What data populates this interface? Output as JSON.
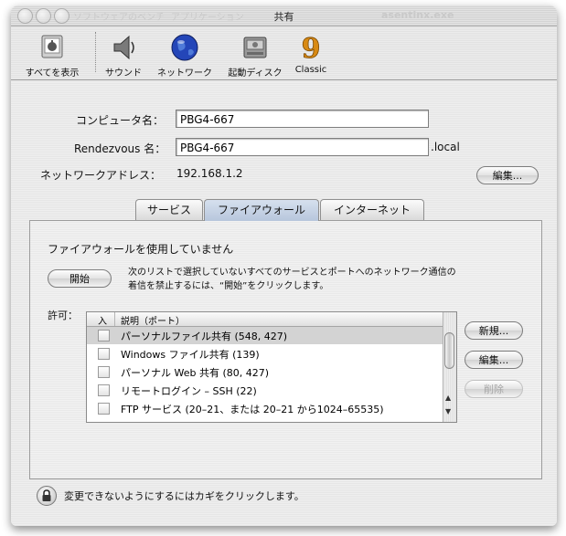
{
  "window": {
    "title": "共有",
    "ghost_left": "ソフトウェアのベンチ",
    "ghost_mid": "アプリケーション",
    "ghost_right": "asentinx.exe"
  },
  "toolbar": {
    "items": [
      {
        "label": "すべてを表示",
        "icon": "apple-icon"
      },
      {
        "label": "サウンド",
        "icon": "speaker-icon"
      },
      {
        "label": "ネットワーク",
        "icon": "globe-icon"
      },
      {
        "label": "起動ディスク",
        "icon": "hard-disk-icon"
      },
      {
        "label": "Classic",
        "icon": "classic-9-icon"
      }
    ]
  },
  "form": {
    "computer_name_label": "コンピュータ名：",
    "computer_name_value": "PBG4-667",
    "rendezvous_label": "Rendezvous 名：",
    "rendezvous_value": "PBG4-667",
    "rendezvous_suffix": ".local",
    "network_address_label": "ネットワークアドレス：",
    "network_address_value": "192.168.1.2",
    "edit_button": "編集..."
  },
  "tabs": [
    {
      "label": "サービス",
      "active": false
    },
    {
      "label": "ファイアウォール",
      "active": true
    },
    {
      "label": "インターネット",
      "active": false
    }
  ],
  "firewall": {
    "status": "ファイアウォールを使用していません",
    "start_button": "開始",
    "description_line1": "次のリストで選択していないすべてのサービスとポートへのネットワーク通信の",
    "description_line2": "着信を禁止するには、“開始”をクリックします。",
    "allow_label": "許可：",
    "col_on": "入",
    "col_desc": "説明（ポート）",
    "rows": [
      {
        "label": "パーソナルファイル共有 (548, 427)",
        "checked": false,
        "selected": true
      },
      {
        "label": "Windows ファイル共有 (139)",
        "checked": false,
        "selected": false
      },
      {
        "label": "パーソナル Web 共有 (80, 427)",
        "checked": false,
        "selected": false
      },
      {
        "label": "リモートログイン – SSH (22)",
        "checked": false,
        "selected": false
      },
      {
        "label": "FTP サービス (20–21、または 20–21 から1024–65535)",
        "checked": false,
        "selected": false
      }
    ],
    "new_button": "新規...",
    "edit_button": "編集...",
    "delete_button": "削除"
  },
  "footer": {
    "lock_text": "変更できないようにするにはカギをクリックします。"
  }
}
